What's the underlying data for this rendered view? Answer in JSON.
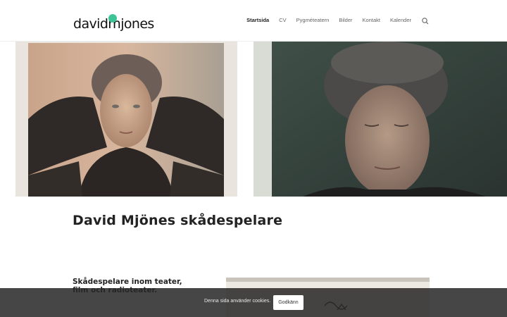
{
  "site": {
    "logo_text": "davidmjones"
  },
  "nav": {
    "items": [
      {
        "label": "Startsida",
        "active": true
      },
      {
        "label": "CV",
        "active": false
      },
      {
        "label": "Pygméteatern",
        "active": false
      },
      {
        "label": "Bilder",
        "active": false
      },
      {
        "label": "Kontakt",
        "active": false
      },
      {
        "label": "Kalender",
        "active": false
      }
    ],
    "search_icon": "search-icon"
  },
  "main": {
    "headline": "David Mjönes skådespelare",
    "subheading": "Skådespelare inom teater, film och radioteater."
  },
  "cookie": {
    "text": "Denna sida använder cookies.",
    "button_label": "Godkänn"
  },
  "colors": {
    "brand_dot": "#3cc497",
    "cookie_bar": "#282828"
  }
}
